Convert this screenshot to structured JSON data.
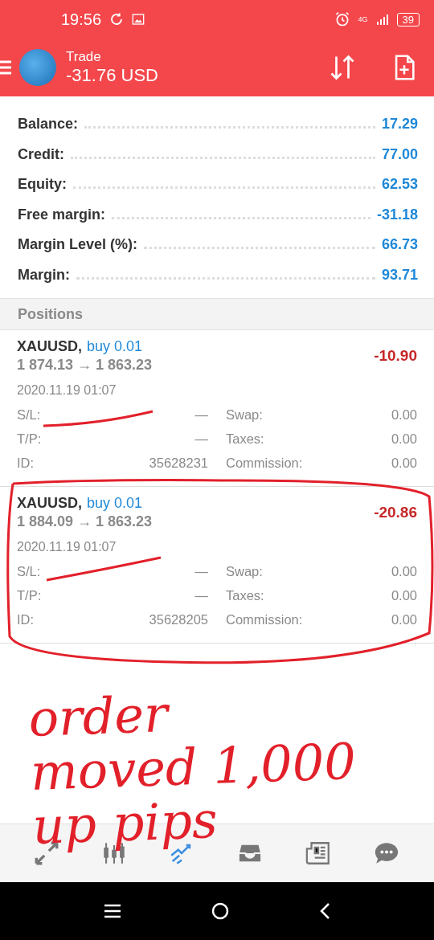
{
  "status_bar": {
    "time": "19:56",
    "network": "4G",
    "battery": "39"
  },
  "header": {
    "title": "Trade",
    "subtitle": "-31.76 USD"
  },
  "summary": [
    {
      "label": "Balance:",
      "value": "17.29"
    },
    {
      "label": "Credit:",
      "value": "77.00"
    },
    {
      "label": "Equity:",
      "value": "62.53"
    },
    {
      "label": "Free margin:",
      "value": "-31.18"
    },
    {
      "label": "Margin Level (%):",
      "value": "66.73"
    },
    {
      "label": "Margin:",
      "value": "93.71"
    }
  ],
  "positions_header": "Positions",
  "positions": [
    {
      "symbol": "XAUUSD,",
      "side": "buy 0.01",
      "prices": "1 874.13 → 1 863.23",
      "profit": "-10.90",
      "time": "2020.11.19 01:07",
      "details": [
        [
          "S/L:",
          "—",
          "Swap:",
          "0.00"
        ],
        [
          "T/P:",
          "—",
          "Taxes:",
          "0.00"
        ],
        [
          "ID:",
          "35628231",
          "Commission:",
          "0.00"
        ]
      ]
    },
    {
      "symbol": "XAUUSD,",
      "side": "buy 0.01",
      "prices": "1 884.09 → 1 863.23",
      "profit": "-20.86",
      "time": "2020.11.19 01:07",
      "details": [
        [
          "S/L:",
          "—",
          "Swap:",
          "0.00"
        ],
        [
          "T/P:",
          "—",
          "Taxes:",
          "0.00"
        ],
        [
          "ID:",
          "35628205",
          "Commission:",
          "0.00"
        ]
      ]
    }
  ],
  "annotation": {
    "lines": [
      "order",
      "moved 1,000",
      "up pips"
    ]
  },
  "bottom_nav": [
    {
      "kind": "quotes",
      "selected": false
    },
    {
      "kind": "chart",
      "selected": false
    },
    {
      "kind": "trade",
      "selected": true
    },
    {
      "kind": "history",
      "selected": false
    },
    {
      "kind": "news",
      "selected": false
    },
    {
      "kind": "messages",
      "selected": false
    }
  ]
}
